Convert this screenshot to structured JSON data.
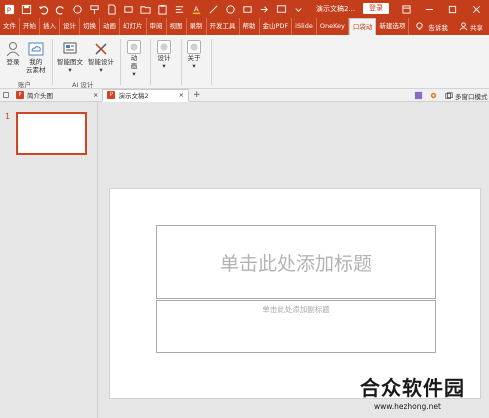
{
  "title_bar": {
    "document_title": "演示文稿2...",
    "login_label": "登录"
  },
  "tabs": [
    {
      "label": "文件"
    },
    {
      "label": "开始"
    },
    {
      "label": "插入"
    },
    {
      "label": "设计"
    },
    {
      "label": "切换"
    },
    {
      "label": "动画"
    },
    {
      "label": "幻灯片"
    },
    {
      "label": "审阅"
    },
    {
      "label": "视图"
    },
    {
      "label": "录制"
    },
    {
      "label": "开发工具"
    },
    {
      "label": "帮助"
    },
    {
      "label": "金山PDF"
    },
    {
      "label": "iSlide"
    },
    {
      "label": "OneKey"
    },
    {
      "label": "口袋动"
    },
    {
      "label": "新建选项"
    }
  ],
  "tell_me": "告诉我",
  "share": "共享",
  "ribbon": {
    "login": "登录",
    "my_cloud_line1": "我的",
    "my_cloud_line2": "云素材",
    "group_account": "账户",
    "smart_image": "智能图文",
    "smart_design": "智能设计",
    "group_ai": "AI 设计",
    "animation_line1": "动",
    "animation_line2": "画",
    "design": "设计",
    "about": "关于"
  },
  "doc_tabs": [
    {
      "label": "简介头图"
    },
    {
      "label": "演示文稿2"
    }
  ],
  "multi_window": "多窗口模式",
  "thumbnail": {
    "number": "1"
  },
  "slide": {
    "title_placeholder": "单击此处添加标题",
    "subtitle_placeholder": "单击此处添加副标题"
  },
  "watermark": {
    "name": "合众软件园",
    "url": "www.hezhong.net"
  },
  "colors": {
    "accent": "#c43e1c",
    "thumb_border": "#d04525"
  }
}
